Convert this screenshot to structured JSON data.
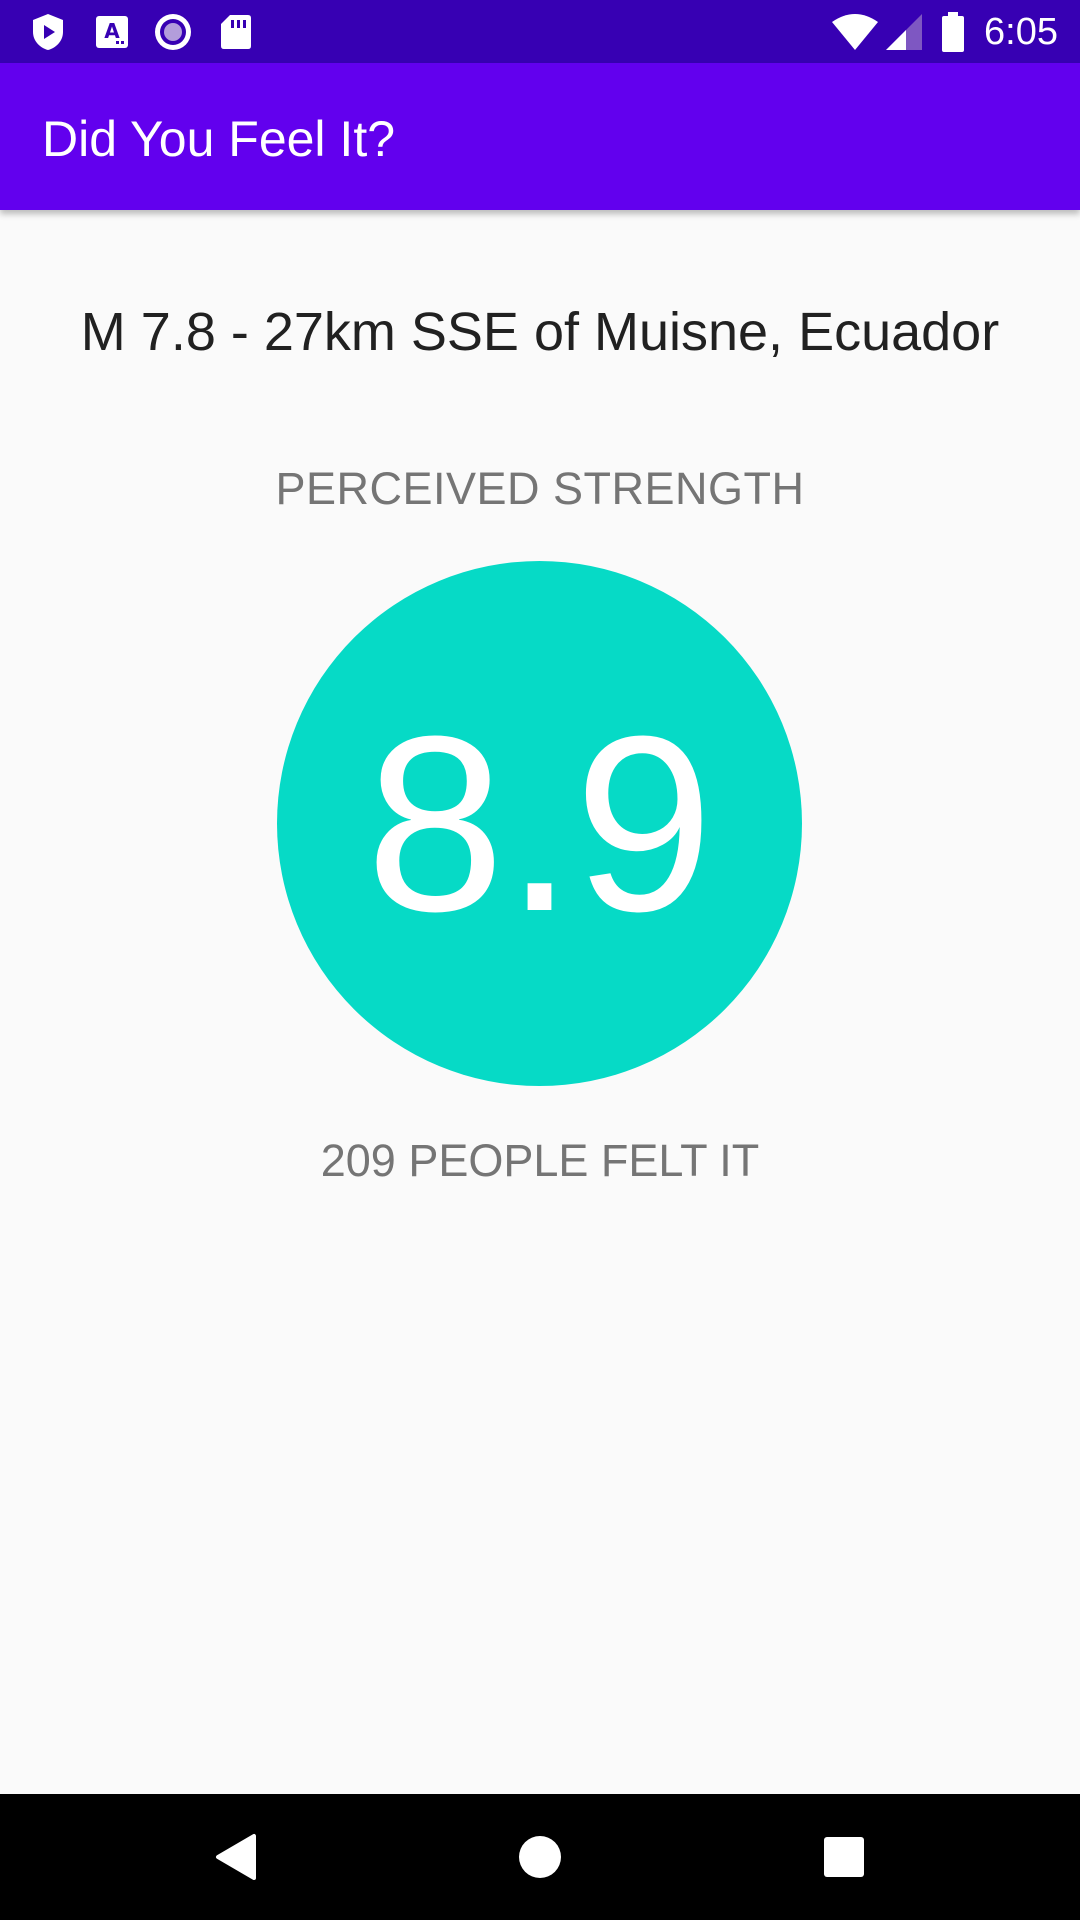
{
  "status_bar": {
    "time": "6:05",
    "background": "#3700b3",
    "left_icons": [
      "shield-icon",
      "font-app-icon",
      "circle-app-icon",
      "sd-card-icon"
    ],
    "right_icons": [
      "wifi-icon",
      "cell-signal-icon",
      "battery-icon"
    ]
  },
  "app_bar": {
    "title": "Did You Feel It?",
    "background": "#6200ee"
  },
  "earthquake": {
    "title": "M 7.8 - 27km SSE of Muisne, Ecuador",
    "strength_label": "PERCEIVED STRENGTH",
    "perceived_strength": "8.9",
    "felt_count_text": "209 PEOPLE FELT IT",
    "circle_color": "#06dac6"
  },
  "nav_bar": {
    "buttons": [
      "back-icon",
      "home-icon",
      "recents-icon"
    ]
  }
}
